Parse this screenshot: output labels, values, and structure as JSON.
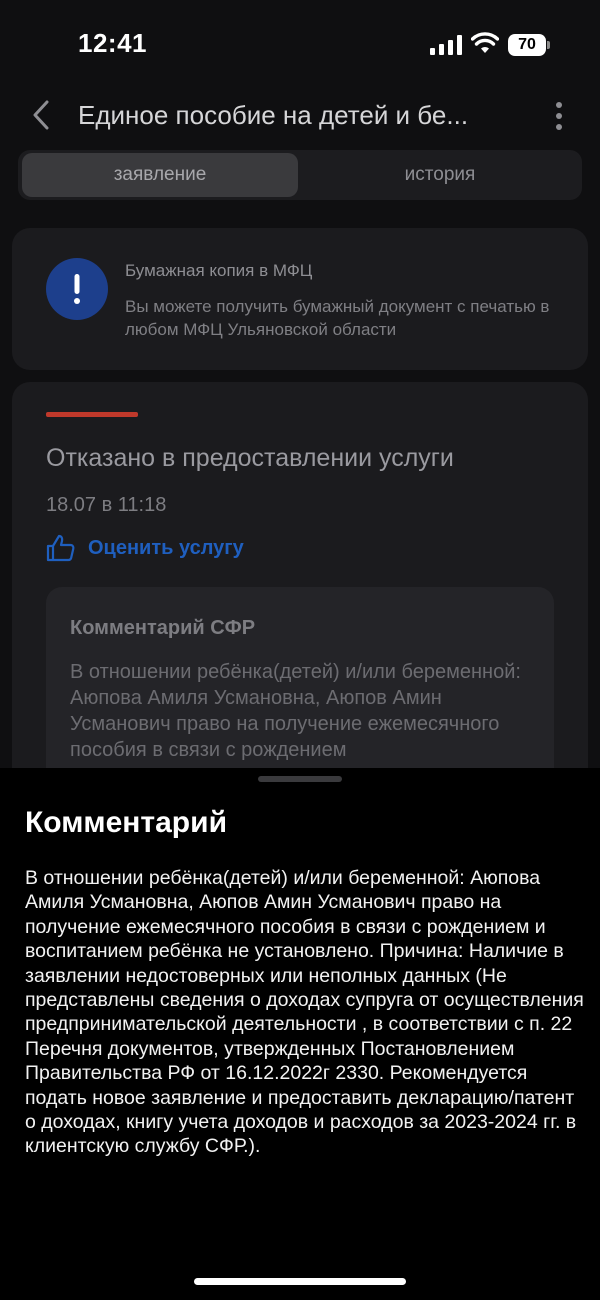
{
  "status_bar": {
    "time": "12:41",
    "battery": "70",
    "icons": [
      "signal-icon",
      "wifi-icon",
      "battery-icon"
    ]
  },
  "header": {
    "title": "Единое пособие на детей и бе...",
    "back_icon": "chevron-left-icon",
    "menu_icon": "more-vertical-icon"
  },
  "tabs": [
    {
      "label": "заявление",
      "active": true
    },
    {
      "label": "история",
      "active": false
    }
  ],
  "info_card": {
    "icon": "exclamation-icon",
    "title": "Бумажная копия в МФЦ",
    "text": "Вы можете получить бумажный документ с печатью в любом МФЦ Ульяновской области"
  },
  "status_card": {
    "status_color": "#c0392b",
    "title": "Отказано в предоставлении услуги",
    "date": "18.07 в 11:18",
    "rate_icon": "thumbs-up-icon",
    "rate_label": "Оценить услугу",
    "comment_title": "Комментарий СФР",
    "comment_preview": "В отношении ребёнка(детей) и/или беременной: Аюпова Амиля Усмановна, Аюпов Амин Усманович право на получение ежемесячного пособия в связи с рождением"
  },
  "sheet": {
    "title": "Комментарий",
    "text": "В отношении ребёнка(детей) и/или беременной: Аюпова Амиля Усмановна, Аюпов Амин Усманович право на получение ежемесячного пособия в связи с рождением и воспитанием ребёнка не установлено. Причина: Наличие в заявлении недостоверных или неполных данных (Не представлены сведения о доходах супруга от осуществления предпринимательской деятельности , в соответствии с п. 22 Перечня документов, утвержденных Постановлением Правительства РФ от 16.12.2022г 2330. Рекомендуется подать новое заявление и предоставить декларацию/патент о доходах, книгу учета доходов и расходов за 2023-2024 гг. в клиентскую службу СФР.)."
  },
  "colors": {
    "accent_blue": "#1f5fbf",
    "info_icon_bg": "#1d3f8c",
    "background": "#0f0f11"
  }
}
